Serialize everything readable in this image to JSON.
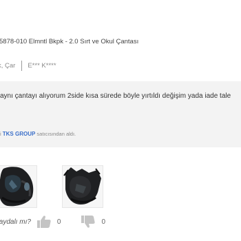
{
  "review": {
    "product_name": "5878-010 Elmntl Bkpk - 2.0 Sırt ve Okul Çantası",
    "meta": {
      "location": "k, Çar",
      "reviewer": "E*** K****"
    },
    "text": "aynı çantayı alıyorum 2side kısa sürede böyle yırtıldı değişim yada iade tale",
    "seller": {
      "prefix": "i",
      "name": "TKS GROUP",
      "suffix": "satıcısından aldı."
    },
    "photos": [
      {
        "icon": "backpack-photo"
      },
      {
        "icon": "backpack-photo"
      }
    ],
    "helpful": {
      "question": "faydalı mı?",
      "like_count": "0",
      "dislike_count": "0",
      "icon_color": "#c4c4c4"
    }
  },
  "colors": {
    "review_bg": "#f3f3f3",
    "seller_link": "#3b6fc9",
    "text_primary": "#333333",
    "text_muted": "#8a8a8a"
  }
}
